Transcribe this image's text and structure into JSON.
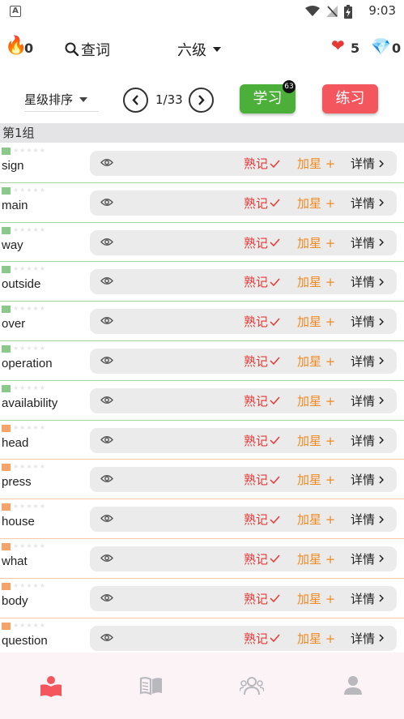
{
  "status_bar": {
    "indicator": "A",
    "time": "9:03"
  },
  "top_bar": {
    "streak_count": "0",
    "search_label": "查词",
    "level_label": "六级",
    "hearts_count": "5",
    "gems_count": "0"
  },
  "controls": {
    "sort_label": "星级排序",
    "page_indicator": "1/33",
    "learn_label": "学习",
    "learn_badge": "63",
    "practice_label": "练习"
  },
  "group_title": "第1组",
  "row_actions": {
    "mastered_label": "熟记",
    "add_star_label": "加星",
    "details_label": "详情"
  },
  "words": [
    {
      "word": "sign",
      "tag_color": "#8bc98a"
    },
    {
      "word": "main",
      "tag_color": "#8bc98a"
    },
    {
      "word": "way",
      "tag_color": "#8bc98a"
    },
    {
      "word": "outside",
      "tag_color": "#8bc98a"
    },
    {
      "word": "over",
      "tag_color": "#8bc98a"
    },
    {
      "word": "operation",
      "tag_color": "#8bc98a"
    },
    {
      "word": "availability",
      "tag_color": "#8bc98a"
    },
    {
      "word": "head",
      "tag_color": "#f4a46a"
    },
    {
      "word": "press",
      "tag_color": "#f4a46a"
    },
    {
      "word": "house",
      "tag_color": "#f4a46a"
    },
    {
      "word": "what",
      "tag_color": "#f4a46a"
    },
    {
      "word": "body",
      "tag_color": "#f4a46a"
    },
    {
      "word": "question",
      "tag_color": "#f4a46a"
    }
  ],
  "bottom_nav": [
    {
      "icon": "learn-book-icon",
      "active": true
    },
    {
      "icon": "open-book-icon",
      "active": false
    },
    {
      "icon": "group-users-icon",
      "active": false
    },
    {
      "icon": "profile-icon",
      "active": false
    }
  ],
  "colors": {
    "accent_green": "#4caf3a",
    "accent_red": "#f4565e",
    "mastered_red": "#e53935",
    "star_orange": "#f08a24"
  }
}
